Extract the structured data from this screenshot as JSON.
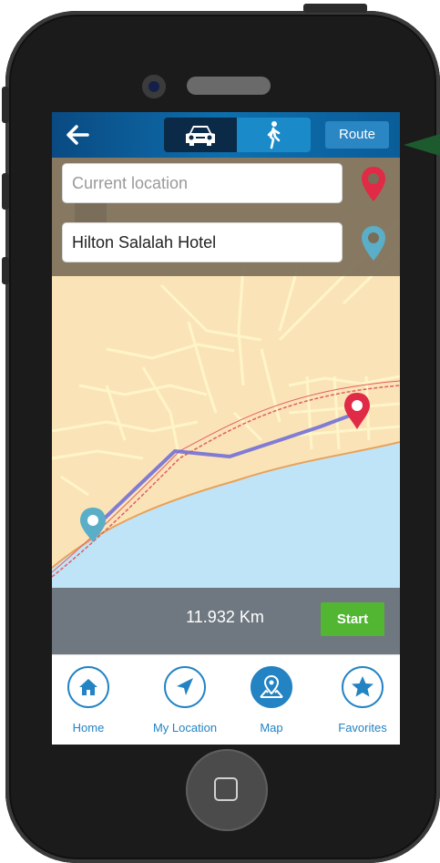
{
  "header": {
    "back_icon": "arrow-left-icon",
    "modes": [
      {
        "name": "car",
        "icon": "car-icon",
        "active": true
      },
      {
        "name": "walk",
        "icon": "walk-icon",
        "active": false
      }
    ],
    "route_label": "Route"
  },
  "search": {
    "from_placeholder": "Current location",
    "from_value": "",
    "to_value": "Hilton Salalah Hotel",
    "from_pin_color": "#e02a46",
    "to_pin_color": "#5aaec8"
  },
  "route": {
    "distance": "11.932 Km",
    "start_label": "Start",
    "line_color": "#6a6ad8"
  },
  "tabs": [
    {
      "label": "Home",
      "icon": "home-icon",
      "active": false
    },
    {
      "label": "My Location",
      "icon": "location-arrow-icon",
      "active": false
    },
    {
      "label": "Map",
      "icon": "map-pin-icon",
      "active": true
    },
    {
      "label": "Favorites",
      "icon": "star-icon",
      "active": false
    }
  ],
  "colors": {
    "accent": "#2383c3",
    "header_dark": "#0b2a47",
    "start_green": "#52b633",
    "sea": "#bfe4f7",
    "land": "#fbe3b8"
  }
}
